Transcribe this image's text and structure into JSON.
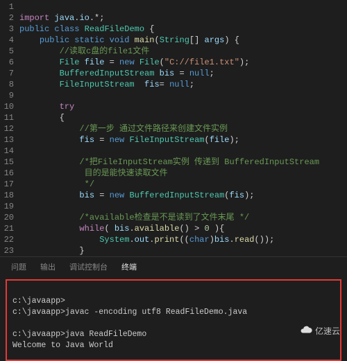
{
  "editor": {
    "lines": [
      {
        "n": "1",
        "html": ""
      },
      {
        "n": "2",
        "html": "<span class='kw-import'>import</span> <span class='var'>java</span><span class='pn'>.</span><span class='var'>io</span><span class='pn'>.*;</span>"
      },
      {
        "n": "3",
        "html": "<span class='kw'>public</span> <span class='kw'>class</span> <span class='type'>ReadFileDemo</span> <span class='pn'>{</span>"
      },
      {
        "n": "4",
        "html": "    <span class='kw'>public</span> <span class='kw'>static</span> <span class='kw'>void</span> <span class='fn'>main</span><span class='pn'>(</span><span class='type'>String</span><span class='pn'>[]</span> <span class='var'>args</span><span class='pn'>) {</span>"
      },
      {
        "n": "5",
        "html": "        <span class='cm'>//读取c盘的file1文件</span>"
      },
      {
        "n": "6",
        "html": "        <span class='type'>File</span> <span class='var'>file</span> <span class='op'>=</span> <span class='kw'>new</span> <span class='type'>File</span><span class='pn'>(</span><span class='str'>\"C://file1.txt\"</span><span class='pn'>);</span>"
      },
      {
        "n": "7",
        "html": "        <span class='type'>BufferedInputStream</span> <span class='var'>bis</span> <span class='op'>=</span> <span class='kw'>null</span><span class='pn'>;</span>"
      },
      {
        "n": "8",
        "html": "        <span class='type'>FileInputStream</span>  <span class='var'>fis</span><span class='op'>=</span> <span class='kw'>null</span><span class='pn'>;</span>"
      },
      {
        "n": "9",
        "html": ""
      },
      {
        "n": "10",
        "html": "        <span class='kw-ctrl'>try</span>"
      },
      {
        "n": "11",
        "html": "        <span class='pn'>{</span>"
      },
      {
        "n": "12",
        "html": "            <span class='cm'>//第一步 通过文件路径来创建文件实例</span>"
      },
      {
        "n": "13",
        "html": "            <span class='var'>fis</span> <span class='op'>=</span> <span class='kw'>new</span> <span class='type'>FileInputStream</span><span class='pn'>(</span><span class='var'>file</span><span class='pn'>);</span>"
      },
      {
        "n": "14",
        "html": ""
      },
      {
        "n": "15",
        "html": "            <span class='cm'>/*把FileInputStream实例 传递到 BufferedInputStream</span>"
      },
      {
        "n": "16",
        "html": "<span class='cm'>             目的是能快速读取文件</span>"
      },
      {
        "n": "17",
        "html": "<span class='cm'>             */</span>"
      },
      {
        "n": "18",
        "html": "            <span class='var'>bis</span> <span class='op'>=</span> <span class='kw'>new</span> <span class='type'>BufferedInputStream</span><span class='pn'>(</span><span class='var'>fis</span><span class='pn'>);</span>"
      },
      {
        "n": "19",
        "html": ""
      },
      {
        "n": "20",
        "html": "            <span class='cm'>/*available检查是不是读到了文件末尾 */</span>"
      },
      {
        "n": "21",
        "html": "            <span class='kw-ctrl'>while</span><span class='pn'>(</span> <span class='var'>bis</span><span class='pn'>.</span><span class='fn'>available</span><span class='pn'>()</span> <span class='op'>&gt;</span> <span class='num'>0</span> <span class='pn'>){</span>"
      },
      {
        "n": "22",
        "html": "                <span class='type'>System</span><span class='pn'>.</span><span class='var'>out</span><span class='pn'>.</span><span class='fn'>print</span><span class='pn'>((</span><span class='kw'>char</span><span class='pn'>)</span><span class='var'>bis</span><span class='pn'>.</span><span class='fn'>read</span><span class='pn'>());</span>"
      },
      {
        "n": "23",
        "html": "            <span class='pn'>}</span>"
      }
    ]
  },
  "panel": {
    "tabs": {
      "problems": "问题",
      "output": "输出",
      "debug": "调试控制台",
      "terminal": "终端"
    },
    "terminal": {
      "line1": "c:\\javaapp>",
      "line2": "c:\\javaapp>javac -encoding utf8 ReadFileDemo.java",
      "line3": "",
      "line4": "c:\\javaapp>java ReadFileDemo",
      "line5": "Welcome to Java World"
    }
  },
  "watermark": {
    "text": "亿速云"
  }
}
